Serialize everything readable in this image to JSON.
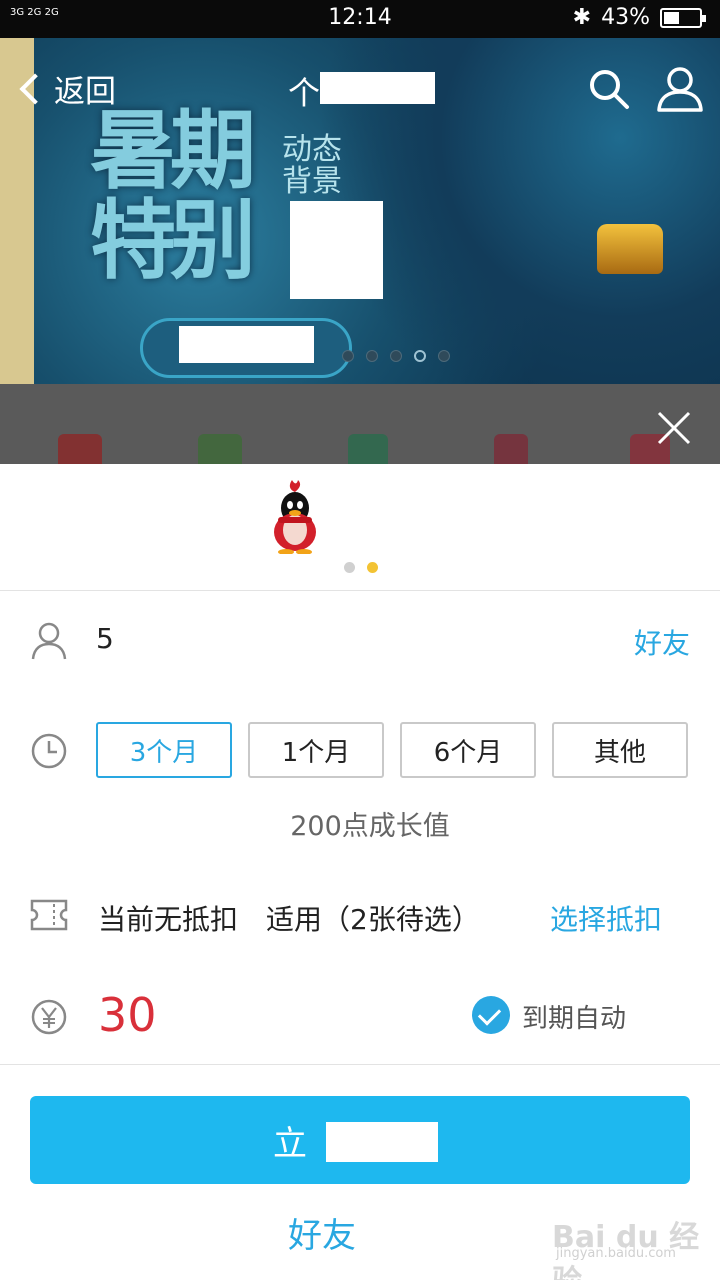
{
  "status_bar": {
    "signal": "3G 2G 2G",
    "time": "12:14",
    "battery": "43%"
  },
  "nav": {
    "back_label": "返回",
    "title_prefix": "个"
  },
  "banner": {
    "headline_1": "暑期",
    "headline_2": "特别",
    "sub_text": "动态背景",
    "carousel_count": 5,
    "carousel_active": 4
  },
  "sheet": {
    "preview_dots": 2,
    "preview_active": 2,
    "account_value": "5",
    "friend_link": "好友",
    "duration_options": [
      {
        "label": "3个月",
        "selected": true
      },
      {
        "label": "1个月",
        "selected": false
      },
      {
        "label": "6个月",
        "selected": false
      },
      {
        "label": "其他",
        "selected": false
      }
    ],
    "growth_text": "200点成长值",
    "discount_text": "当前无抵扣",
    "discount_applicable": "适用（2张待选）",
    "discount_link": "选择抵扣",
    "price": "30",
    "auto_renew_label": "到期自动",
    "auto_renew_checked": true,
    "buy_button_label": "立",
    "gift_label": "好友",
    "watermark": "Bai du 经验",
    "watermark_url": "jingyan.baidu.com"
  },
  "colors": {
    "accent": "#29a7e1",
    "button": "#1eb8ef",
    "price": "#d9303a",
    "dot_active": "#f3c334"
  }
}
